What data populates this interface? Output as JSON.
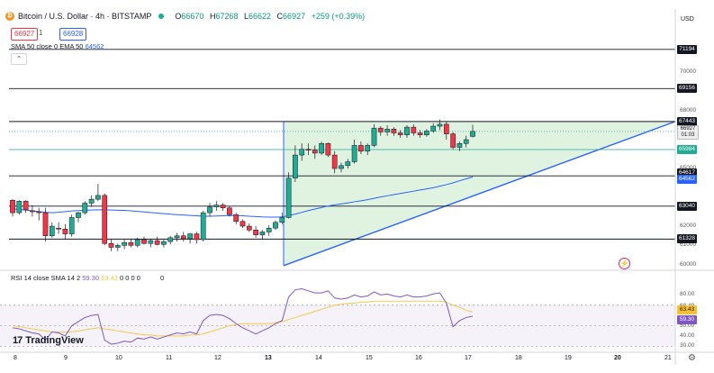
{
  "header": {
    "symbol_icon": "bitcoin-icon",
    "title": "Bitcoin / U.S. Dollar · 4h · BITSTAMP",
    "ohlc": {
      "o_label": "O",
      "o": "66670",
      "h_label": "H",
      "h": "67268",
      "l_label": "L",
      "l": "66622",
      "c_label": "C",
      "c": "66927",
      "change": "+259 (+0.39%)"
    },
    "sell_price": "66927",
    "spread": "1",
    "buy_price": "66928",
    "indicator": "SMA 50 close 0 EMA 50",
    "indicator_value": "64562",
    "collapse_glyph": "⌃"
  },
  "rsi": {
    "label": "RSI 14 close SMA 14 2",
    "rsi_value": "59.30",
    "sma_value": "63.43",
    "extras": "0 0 0 0",
    "extra2": "0"
  },
  "price_axis": {
    "currency": "USD",
    "ticks": [
      "70000",
      "68000",
      "65000",
      "62000",
      "61000",
      "60000"
    ],
    "tags": {
      "t71194": "71194",
      "t69156": "69156",
      "t67443": "67443",
      "current": "66927",
      "countdown": "01:03",
      "t65984": "65984",
      "t64617": "64617",
      "t64562": "64562",
      "t63040": "63040",
      "t61328": "61328"
    }
  },
  "rsi_axis": {
    "ticks": [
      "68.49",
      "64.93",
      "50.00",
      "40.00",
      "30.00"
    ],
    "top_tick": "80.00",
    "sma_tag": "63.43",
    "rsi_tag": "59.30"
  },
  "time_axis": [
    "8",
    "9",
    "10",
    "11",
    "12",
    "13",
    "14",
    "15",
    "16",
    "17",
    "18",
    "19",
    "20",
    "21"
  ],
  "brand": {
    "name": "TradingView",
    "mark": "17"
  },
  "colors": {
    "up": "#22ab94",
    "down": "#f23645",
    "ema": "#2962ff",
    "rsi": "#7e57c2",
    "rsi_sma": "#f7c948",
    "triangle_fill": "#d8f0d8"
  },
  "chart_data": {
    "type": "candlestick",
    "timeframe": "4h",
    "y_unit": "USD",
    "candles": [
      {
        "o": 63350,
        "h": 63400,
        "l": 62500,
        "c": 62700
      },
      {
        "o": 62700,
        "h": 63350,
        "l": 62600,
        "c": 63300
      },
      {
        "o": 63300,
        "h": 63350,
        "l": 62700,
        "c": 62850
      },
      {
        "o": 62800,
        "h": 63100,
        "l": 62500,
        "c": 62750
      },
      {
        "o": 62750,
        "h": 62950,
        "l": 62300,
        "c": 62700
      },
      {
        "o": 62700,
        "h": 62950,
        "l": 61200,
        "c": 61500
      },
      {
        "o": 61500,
        "h": 62200,
        "l": 61400,
        "c": 62000
      },
      {
        "o": 61900,
        "h": 62200,
        "l": 61600,
        "c": 61850
      },
      {
        "o": 61850,
        "h": 62100,
        "l": 61300,
        "c": 61600
      },
      {
        "o": 61600,
        "h": 62600,
        "l": 61450,
        "c": 62450
      },
      {
        "o": 62450,
        "h": 62750,
        "l": 62200,
        "c": 62700
      },
      {
        "o": 62700,
        "h": 63300,
        "l": 62600,
        "c": 63200
      },
      {
        "o": 63200,
        "h": 63600,
        "l": 63000,
        "c": 63400
      },
      {
        "o": 63400,
        "h": 64200,
        "l": 63300,
        "c": 63600
      },
      {
        "o": 63600,
        "h": 63700,
        "l": 61000,
        "c": 61100
      },
      {
        "o": 61100,
        "h": 61300,
        "l": 60700,
        "c": 60900
      },
      {
        "o": 60900,
        "h": 61100,
        "l": 60700,
        "c": 61000
      },
      {
        "o": 61000,
        "h": 61300,
        "l": 60800,
        "c": 61150
      },
      {
        "o": 61150,
        "h": 61350,
        "l": 60900,
        "c": 61000
      },
      {
        "o": 61000,
        "h": 61400,
        "l": 60900,
        "c": 61300
      },
      {
        "o": 61300,
        "h": 61450,
        "l": 61050,
        "c": 61100
      },
      {
        "o": 61100,
        "h": 61350,
        "l": 60900,
        "c": 61250
      },
      {
        "o": 61250,
        "h": 61450,
        "l": 61000,
        "c": 61050
      },
      {
        "o": 61050,
        "h": 61300,
        "l": 60900,
        "c": 61200
      },
      {
        "o": 61200,
        "h": 61500,
        "l": 61050,
        "c": 61400
      },
      {
        "o": 61400,
        "h": 61650,
        "l": 61200,
        "c": 61500
      },
      {
        "o": 61500,
        "h": 61700,
        "l": 61200,
        "c": 61350
      },
      {
        "o": 61350,
        "h": 61650,
        "l": 61100,
        "c": 61600
      },
      {
        "o": 61600,
        "h": 61700,
        "l": 61100,
        "c": 61300
      },
      {
        "o": 61300,
        "h": 62800,
        "l": 61200,
        "c": 62700
      },
      {
        "o": 62700,
        "h": 63200,
        "l": 62500,
        "c": 63000
      },
      {
        "o": 63000,
        "h": 63300,
        "l": 62800,
        "c": 63100
      },
      {
        "o": 63100,
        "h": 63200,
        "l": 62800,
        "c": 62950
      },
      {
        "o": 62950,
        "h": 63050,
        "l": 62500,
        "c": 62600
      },
      {
        "o": 62600,
        "h": 62700,
        "l": 62100,
        "c": 62250
      },
      {
        "o": 62250,
        "h": 62350,
        "l": 61900,
        "c": 62000
      },
      {
        "o": 62000,
        "h": 62150,
        "l": 61700,
        "c": 61800
      },
      {
        "o": 61800,
        "h": 62000,
        "l": 61400,
        "c": 61550
      },
      {
        "o": 61550,
        "h": 61800,
        "l": 61300,
        "c": 61700
      },
      {
        "o": 61700,
        "h": 62050,
        "l": 61500,
        "c": 61900
      },
      {
        "o": 61900,
        "h": 62300,
        "l": 61800,
        "c": 62200
      },
      {
        "o": 62200,
        "h": 62700,
        "l": 62100,
        "c": 62450
      },
      {
        "o": 62450,
        "h": 64800,
        "l": 62400,
        "c": 64500
      },
      {
        "o": 64500,
        "h": 66200,
        "l": 64300,
        "c": 65700
      },
      {
        "o": 65700,
        "h": 66300,
        "l": 65400,
        "c": 66000
      },
      {
        "o": 66000,
        "h": 66300,
        "l": 65700,
        "c": 65950
      },
      {
        "o": 65950,
        "h": 66200,
        "l": 65500,
        "c": 65800
      },
      {
        "o": 65800,
        "h": 66400,
        "l": 65700,
        "c": 66300
      },
      {
        "o": 66300,
        "h": 66350,
        "l": 65600,
        "c": 65700
      },
      {
        "o": 65700,
        "h": 65900,
        "l": 64750,
        "c": 65000
      },
      {
        "o": 65000,
        "h": 65300,
        "l": 64800,
        "c": 65150
      },
      {
        "o": 65150,
        "h": 65500,
        "l": 65000,
        "c": 65350
      },
      {
        "o": 65350,
        "h": 66500,
        "l": 65250,
        "c": 66200
      },
      {
        "o": 66200,
        "h": 66400,
        "l": 65750,
        "c": 65900
      },
      {
        "o": 65900,
        "h": 66300,
        "l": 65700,
        "c": 66200
      },
      {
        "o": 66200,
        "h": 67300,
        "l": 66100,
        "c": 67100
      },
      {
        "o": 67100,
        "h": 67200,
        "l": 66700,
        "c": 66900
      },
      {
        "o": 66900,
        "h": 67250,
        "l": 66700,
        "c": 67050
      },
      {
        "o": 67050,
        "h": 67150,
        "l": 66700,
        "c": 66850
      },
      {
        "o": 66850,
        "h": 67000,
        "l": 66600,
        "c": 66750
      },
      {
        "o": 66750,
        "h": 67250,
        "l": 66600,
        "c": 67150
      },
      {
        "o": 67150,
        "h": 67300,
        "l": 66700,
        "c": 66850
      },
      {
        "o": 66850,
        "h": 67000,
        "l": 66600,
        "c": 66750
      },
      {
        "o": 66750,
        "h": 67050,
        "l": 66650,
        "c": 66950
      },
      {
        "o": 66950,
        "h": 67350,
        "l": 66850,
        "c": 67200
      },
      {
        "o": 67200,
        "h": 67550,
        "l": 67000,
        "c": 67300
      },
      {
        "o": 67300,
        "h": 67450,
        "l": 66500,
        "c": 66800
      },
      {
        "o": 66800,
        "h": 66900,
        "l": 66000,
        "c": 66100
      },
      {
        "o": 66100,
        "h": 66400,
        "l": 65900,
        "c": 66300
      },
      {
        "o": 66300,
        "h": 66700,
        "l": 66100,
        "c": 66500
      },
      {
        "o": 66670,
        "h": 67268,
        "l": 66622,
        "c": 66927
      }
    ],
    "ema50": [
      62900,
      62870,
      62840,
      62800,
      62760,
      62720,
      62700,
      62720,
      62760,
      62790,
      62810,
      62830,
      62840,
      62850,
      62850,
      62840,
      62830,
      62820,
      62800,
      62770,
      62740,
      62710,
      62680,
      62650,
      62620,
      62600,
      62580,
      62560,
      62540,
      62520,
      62520,
      62530,
      62540,
      62550,
      62550,
      62540,
      62520,
      62500,
      62480,
      62470,
      62470,
      62480,
      62550,
      62630,
      62720,
      62810,
      62890,
      62970,
      63050,
      63110,
      63160,
      63210,
      63270,
      63320,
      63380,
      63450,
      63520,
      63580,
      63640,
      63700,
      63760,
      63820,
      63880,
      63940,
      64000,
      64080,
      64160,
      64250,
      64360,
      64460,
      64562
    ],
    "rsi_values": [
      48,
      47,
      45,
      43,
      42,
      36,
      44,
      43,
      40,
      50,
      54,
      58,
      60,
      61,
      36,
      32,
      33,
      35,
      34,
      38,
      37,
      39,
      37,
      39,
      41,
      43,
      42,
      44,
      42,
      55,
      60,
      61,
      60,
      57,
      52,
      48,
      45,
      42,
      45,
      48,
      52,
      55,
      78,
      85,
      86,
      84,
      82,
      82,
      84,
      77,
      76,
      77,
      80,
      78,
      79,
      83,
      80,
      81,
      79,
      78,
      80,
      78,
      78,
      79,
      81,
      82,
      72,
      49,
      55,
      58,
      59.3
    ],
    "rsi_sma_values": [
      50,
      49,
      48,
      47,
      46,
      45,
      44,
      44,
      44,
      44,
      45,
      46,
      47,
      48,
      47,
      46,
      45,
      44,
      43,
      42,
      41,
      41,
      40,
      40,
      40,
      40,
      40,
      41,
      41,
      42,
      44,
      46,
      48,
      50,
      51,
      52,
      52,
      52,
      52,
      52,
      53,
      54,
      56,
      58,
      60,
      62,
      64,
      66,
      68,
      70,
      71,
      72,
      72,
      73,
      73,
      74,
      74,
      74,
      74,
      74,
      74,
      74,
      74,
      74,
      74,
      74,
      73,
      70,
      68,
      65,
      63.43
    ],
    "horizontal_levels": [
      71194,
      69156,
      67443,
      65984,
      64617,
      63040,
      61328
    ],
    "rsi_levels": [
      30,
      50,
      70
    ],
    "rsi_range": [
      25,
      90
    ],
    "price_range": [
      59800,
      71700
    ],
    "ascending_triangle": {
      "resistance": 67443,
      "support_start_price": 59950,
      "support_end_price": 67443
    }
  }
}
